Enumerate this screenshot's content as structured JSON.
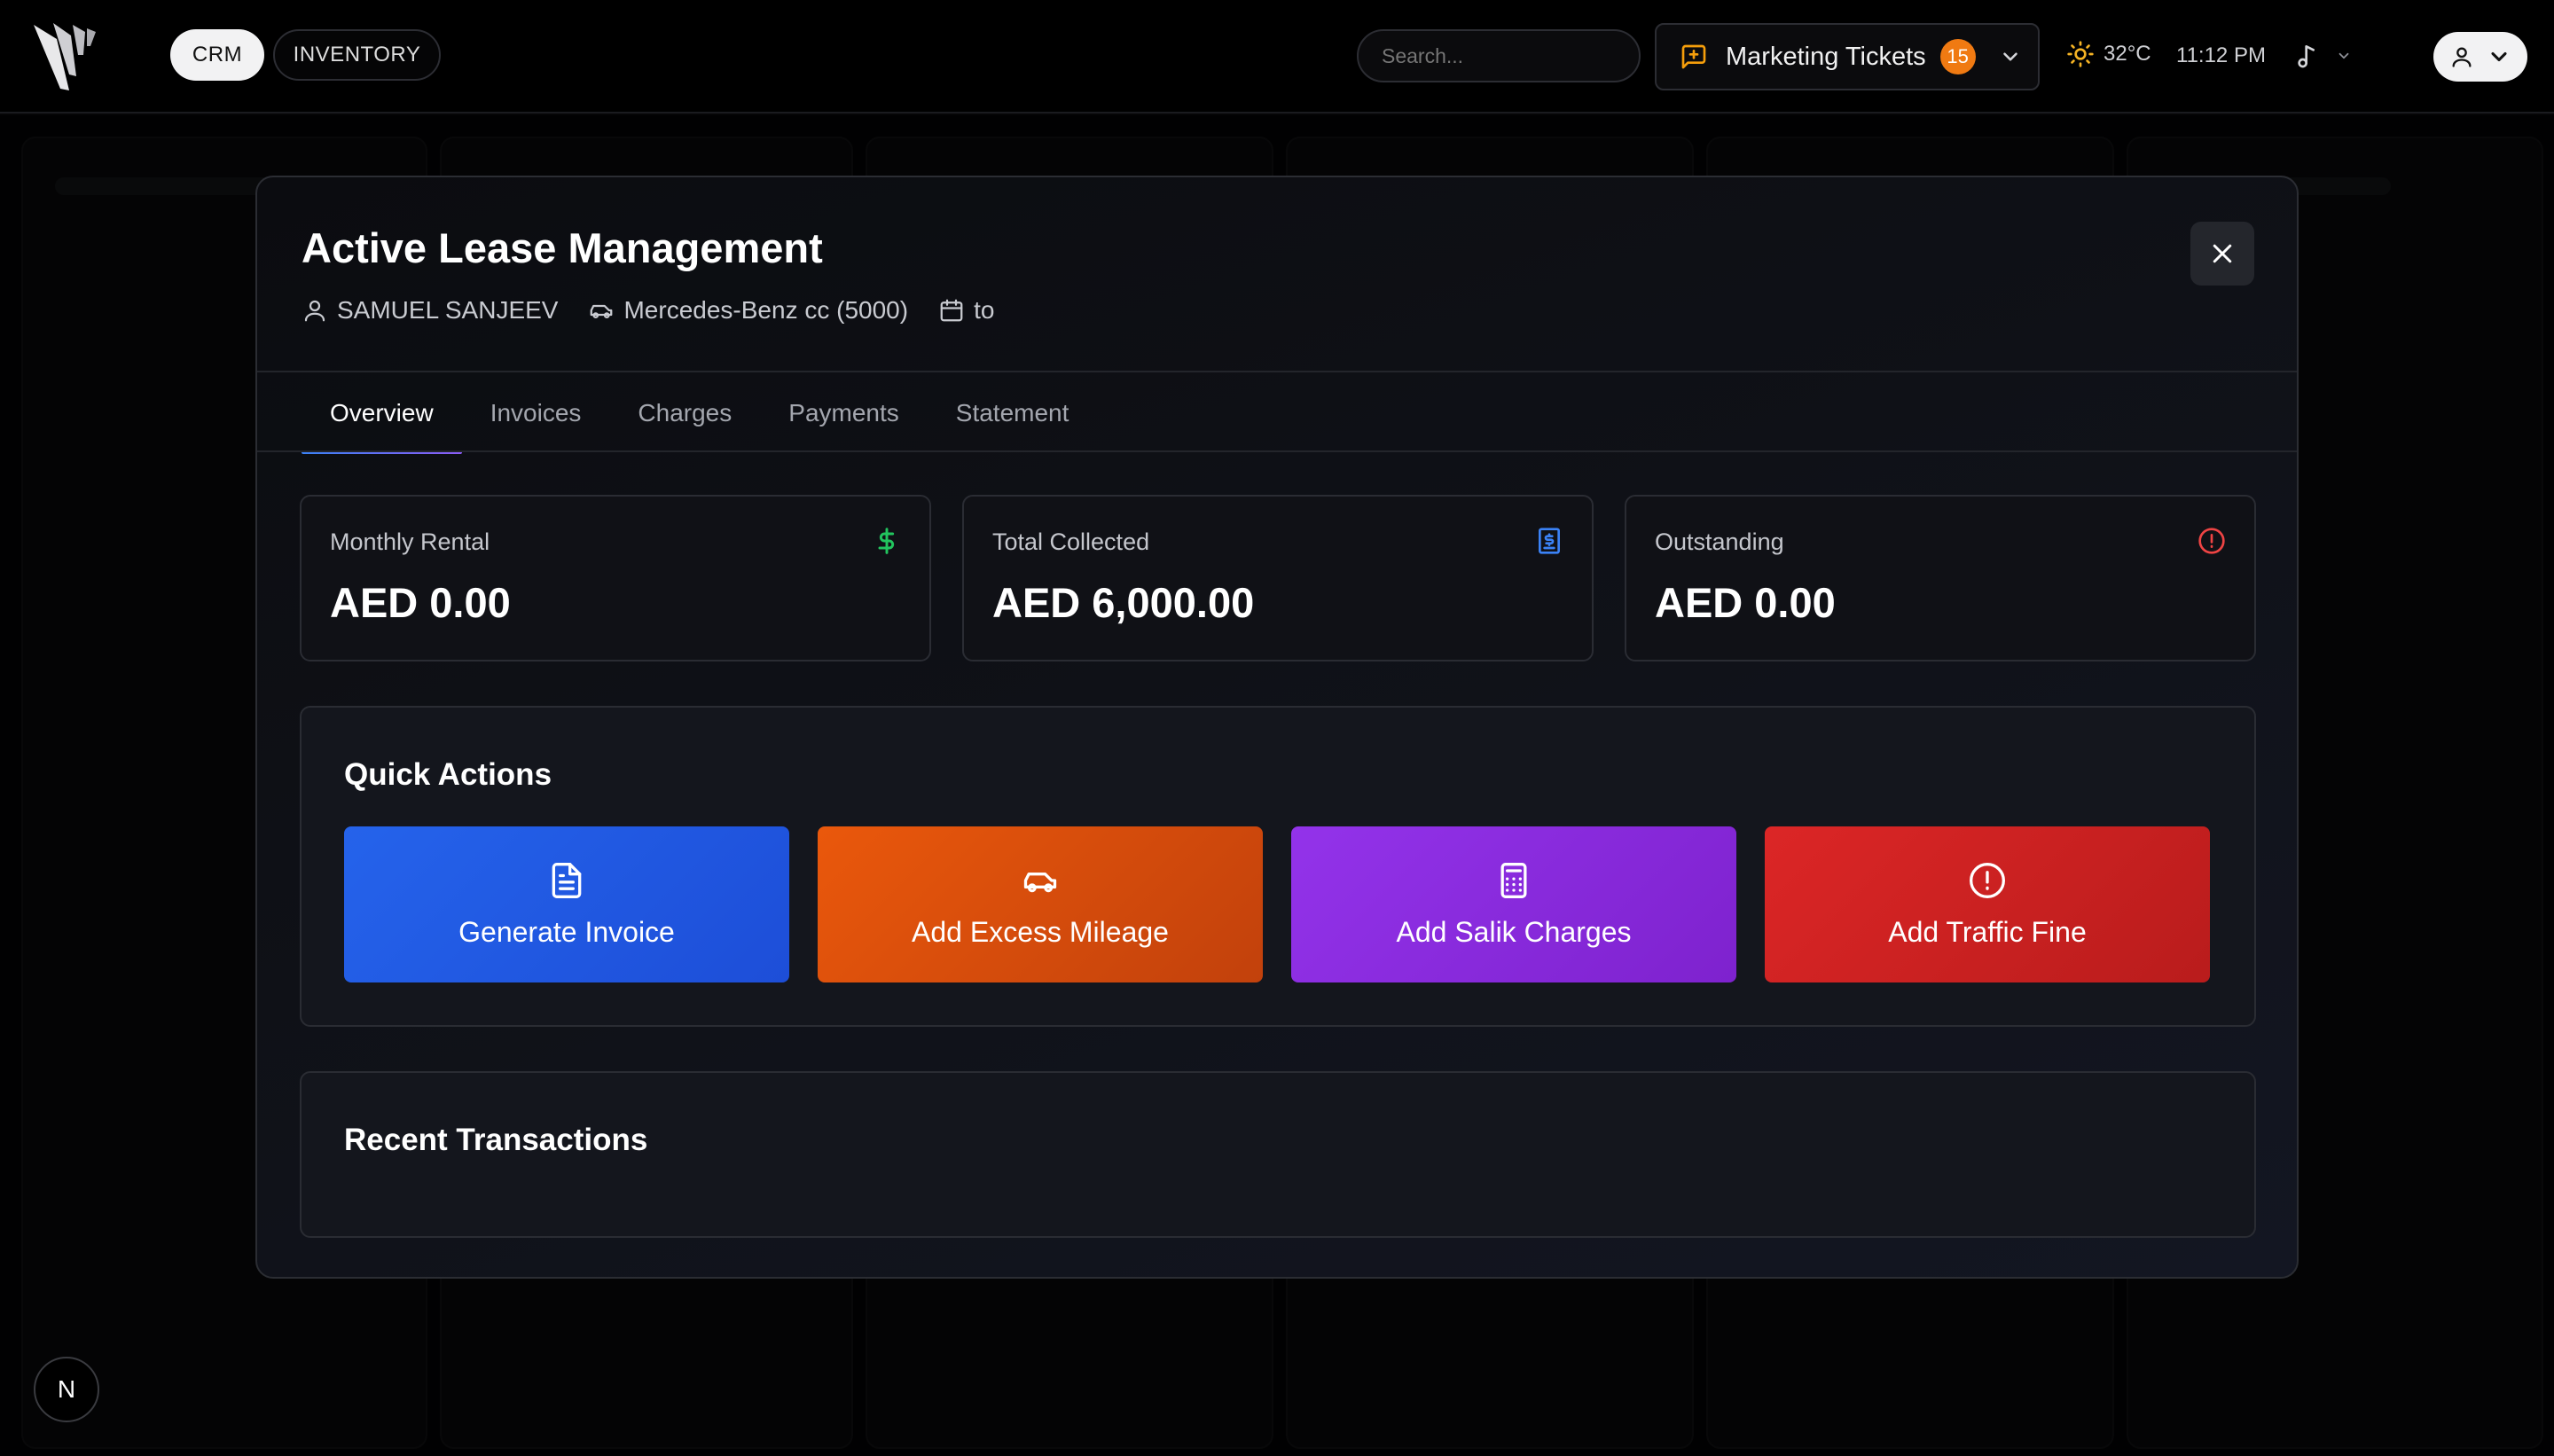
{
  "nav": {
    "crm_label": "CRM",
    "inventory_label": "INVENTORY",
    "search_placeholder": "Search...",
    "tickets_label": "Marketing Tickets",
    "tickets_count": "15",
    "temperature": "32°C",
    "time": "11:12 PM"
  },
  "next_badge": "N",
  "modal": {
    "title": "Active Lease Management",
    "customer": "SAMUEL SANJEEV",
    "vehicle": "Mercedes-Benz cc (5000)",
    "period": "to",
    "tabs": [
      "Overview",
      "Invoices",
      "Charges",
      "Payments",
      "Statement"
    ],
    "active_tab": "Overview",
    "stats": [
      {
        "label": "Monthly Rental",
        "value": "AED 0.00",
        "icon": "dollar-icon",
        "color": "#22c55e"
      },
      {
        "label": "Total Collected",
        "value": "AED 6,000.00",
        "icon": "receipt-icon",
        "color": "#3b82f6"
      },
      {
        "label": "Outstanding",
        "value": "AED 0.00",
        "icon": "alert-circle-icon",
        "color": "#ef4444"
      }
    ],
    "quick_actions": {
      "title": "Quick Actions",
      "items": [
        {
          "label": "Generate Invoice",
          "icon": "file-text-icon",
          "color": "#2563eb"
        },
        {
          "label": "Add Excess Mileage",
          "icon": "car-icon",
          "color": "#ea580c"
        },
        {
          "label": "Add Salik Charges",
          "icon": "calculator-icon",
          "color": "#9333ea"
        },
        {
          "label": "Add Traffic Fine",
          "icon": "alert-circle-icon",
          "color": "#dc2626"
        }
      ]
    },
    "recent_transactions": {
      "title": "Recent Transactions"
    }
  }
}
